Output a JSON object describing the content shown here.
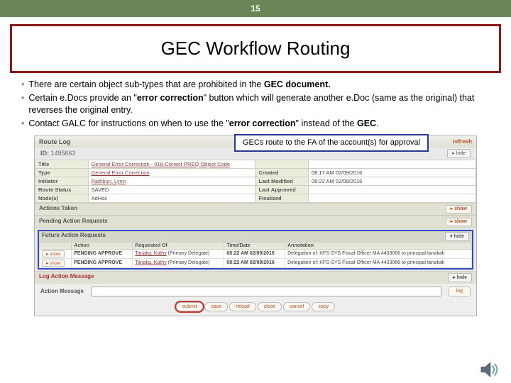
{
  "slide_number": "15",
  "title": "GEC Workflow Routing",
  "bullets": [
    "There are certain object sub-types that are prohibited in the <b>GEC document.</b>",
    "Certain e.Docs provide an \"<b>error correction</b>\" button which will generate another e.Doc (same as the original) that reverses the original entry.",
    "Contact GALC for instructions on when to use the \"<b>error correction</b>\" instead of the <b>GEC</b>."
  ],
  "callout": "GECs route to the FA of the account(s) for approval",
  "routelog": {
    "header": "Route Log",
    "refresh": "refresh",
    "id_label": "ID:",
    "id": "1495663",
    "hide": "▸ hide",
    "rows": [
      {
        "l": "Title",
        "v": "General Error Correction - 018-Correct PREQ Object Code",
        "r": "",
        "rv": ""
      },
      {
        "l": "Type",
        "v": "General Error Correction",
        "r": "Created",
        "rv": "08:17 AM 02/09/2016"
      },
      {
        "l": "Initiator",
        "v": "Rathbun, Lynn",
        "r": "Last Modified",
        "rv": "08:22 AM 02/09/2016"
      },
      {
        "l": "Route Status",
        "v": "SAVED",
        "r": "Last Approved",
        "rv": ""
      },
      {
        "l": "Node(s)",
        "v": "AdHoc",
        "r": "Finalized",
        "rv": ""
      }
    ],
    "actions_taken": "Actions Taken",
    "pending": "Pending Action Requests",
    "show": "▸ show",
    "future": {
      "title": "Future Action Requests",
      "hide": "▾ hide",
      "cols": [
        "",
        "Action",
        "Requested Of",
        "Time/Date",
        "Annotation"
      ],
      "rows": [
        {
          "btn": "▸ show",
          "action": "PENDING APPROVE",
          "who": "Tanaka, Kathy",
          "who2": "(Primary Delegate)",
          "time": "08:22 AM 02/09/2016",
          "note": "Delegation of: KFS-SYS Fiscal Officer MA 4433066 to principal tanakak"
        },
        {
          "btn": "▸ show",
          "action": "PENDING APPROVE",
          "who": "Tanaka, Kathy",
          "who2": "(Primary Delegate)",
          "time": "08:22 AM 02/09/2016",
          "note": "Delegation of: KFS-SYS Fiscal Officer MA 4433066 to principal tanakak"
        }
      ]
    },
    "log_msg": "Log Action Message",
    "action_label": "Action Message",
    "log_btn": "log",
    "bottom": [
      "submit",
      "save",
      "reload",
      "close",
      "cancel",
      "copy"
    ]
  }
}
